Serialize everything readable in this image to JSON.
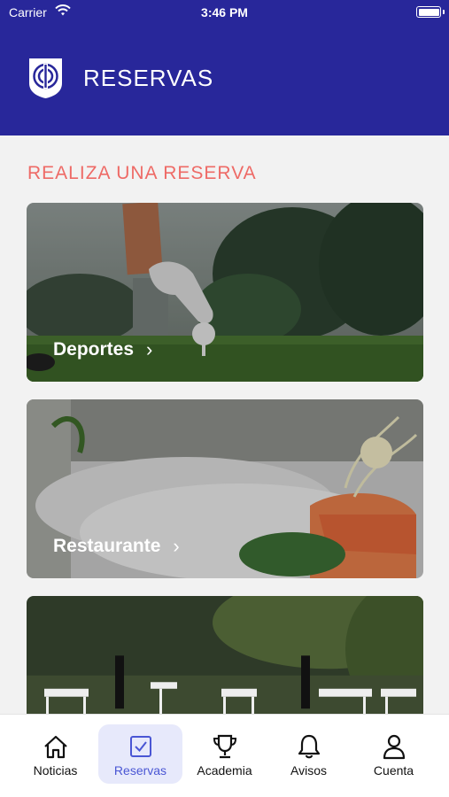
{
  "status": {
    "carrier": "Carrier",
    "time": "3:46 PM"
  },
  "header": {
    "title": "RESERVAS",
    "logo_icon": "club-crest-icon"
  },
  "section": {
    "title": "REALIZA UNA RESERVA"
  },
  "cards": [
    {
      "label": "Deportes"
    },
    {
      "label": "Restaurante"
    },
    {
      "label": ""
    }
  ],
  "tabs": [
    {
      "label": "Noticias",
      "icon": "home-icon"
    },
    {
      "label": "Reservas",
      "icon": "checkbox-icon",
      "active": true
    },
    {
      "label": "Academia",
      "icon": "trophy-icon"
    },
    {
      "label": "Avisos",
      "icon": "bell-icon"
    },
    {
      "label": "Cuenta",
      "icon": "user-icon"
    }
  ],
  "colors": {
    "brand": "#28279a",
    "accent": "#ee6a66",
    "active_tab": "#4a56d4",
    "active_tab_bg": "#e7e9fb"
  }
}
